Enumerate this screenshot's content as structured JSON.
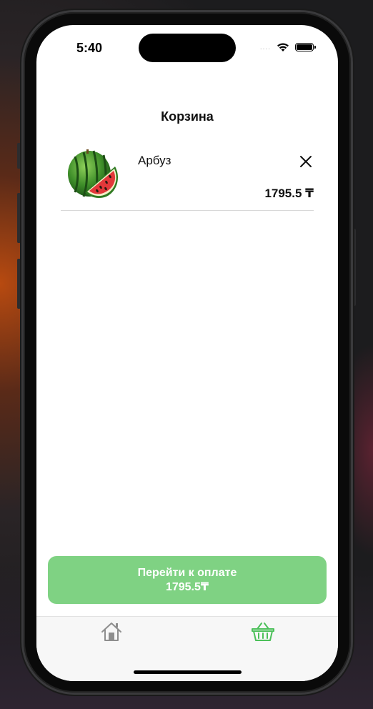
{
  "status_bar": {
    "time": "5:40",
    "signal": "....",
    "wifi_icon": "wifi-icon",
    "battery_icon": "battery-icon"
  },
  "header": {
    "title": "Корзина"
  },
  "cart": {
    "items": [
      {
        "name": "Арбуз",
        "price": "1795.5 ₸",
        "image_icon": "watermelon-image",
        "remove_icon": "close-icon"
      }
    ]
  },
  "checkout": {
    "label": "Перейти к оплате",
    "total": "1795.5₸",
    "color": "#7fd283"
  },
  "tab_bar": {
    "tabs": [
      {
        "icon": "home-icon",
        "active": false,
        "color": "#8e8e8e"
      },
      {
        "icon": "basket-icon",
        "active": true,
        "color": "#4cc05a"
      }
    ]
  }
}
